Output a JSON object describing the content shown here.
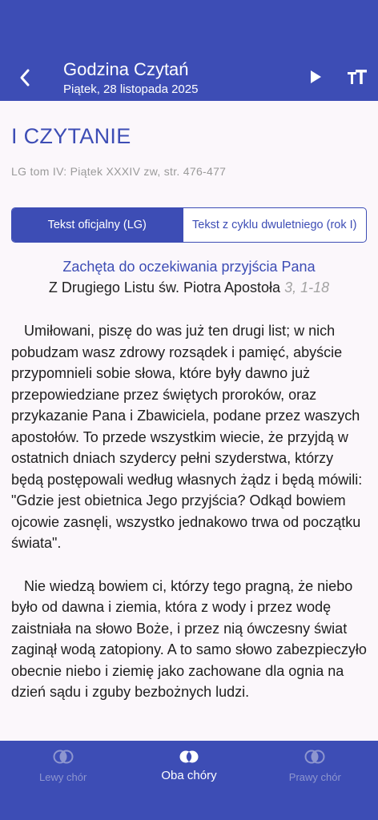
{
  "header": {
    "title": "Godzina Czytań",
    "date": "Piątek, 28 listopada 2025",
    "back_icon": "chevron-left-icon",
    "play_icon": "play-icon",
    "font_icon": "text-size-icon",
    "bg_color": "#3d4db5"
  },
  "section": {
    "title": "I CZYTANIE",
    "source_ref": "LG tom IV: Piątek XXXIV zw, str. 476-477"
  },
  "toggle": {
    "official_label": "Tekst oficjalny (LG)",
    "biennial_label": "Tekst z cyklu dwuletniego (rok I)"
  },
  "reading": {
    "title": "Zachęta do oczekiwania przyjścia Pana",
    "source": "Z Drugiego Listu św. Piotra Apostoła",
    "verse_ref": "3, 1-18",
    "paragraphs": [
      "Umiłowani, piszę do was już ten drugi list; w nich pobudzam wasz zdrowy rozsądek i pamięć, abyście przypomnieli sobie słowa, które były dawno już przepowiedziane przez świętych proroków, oraz przykazanie Pana i Zbawiciela, podane przez waszych apostołów. To przede wszystkim wiecie, że przyjdą w ostatnich dniach szydercy pełni szyderstwa, którzy będą postępowali według własnych żądz i będą mówili: \"Gdzie jest obietnica Jego przyjścia? Odkąd bowiem ojcowie zasnęli, wszystko jednakowo trwa od początku świata\".",
      "Nie wiedzą bowiem ci, którzy tego pragną, że niebo było od dawna i ziemia, która z wody i przez wodę zaistniała na słowo Boże, i przez nią ówczesny świat zaginął wodą zatopiony. A to samo słowo zabezpieczyło obecnie niebo i ziemię jako zachowane dla ognia na dzień sądu i zguby bezbożnych ludzi."
    ]
  },
  "bottom_nav": {
    "left": "Lewy chór",
    "both": "Oba chóry",
    "right": "Prawy chór",
    "left_icon": "choir-left-icon",
    "both_icon": "choir-both-icon",
    "right_icon": "choir-right-icon"
  }
}
